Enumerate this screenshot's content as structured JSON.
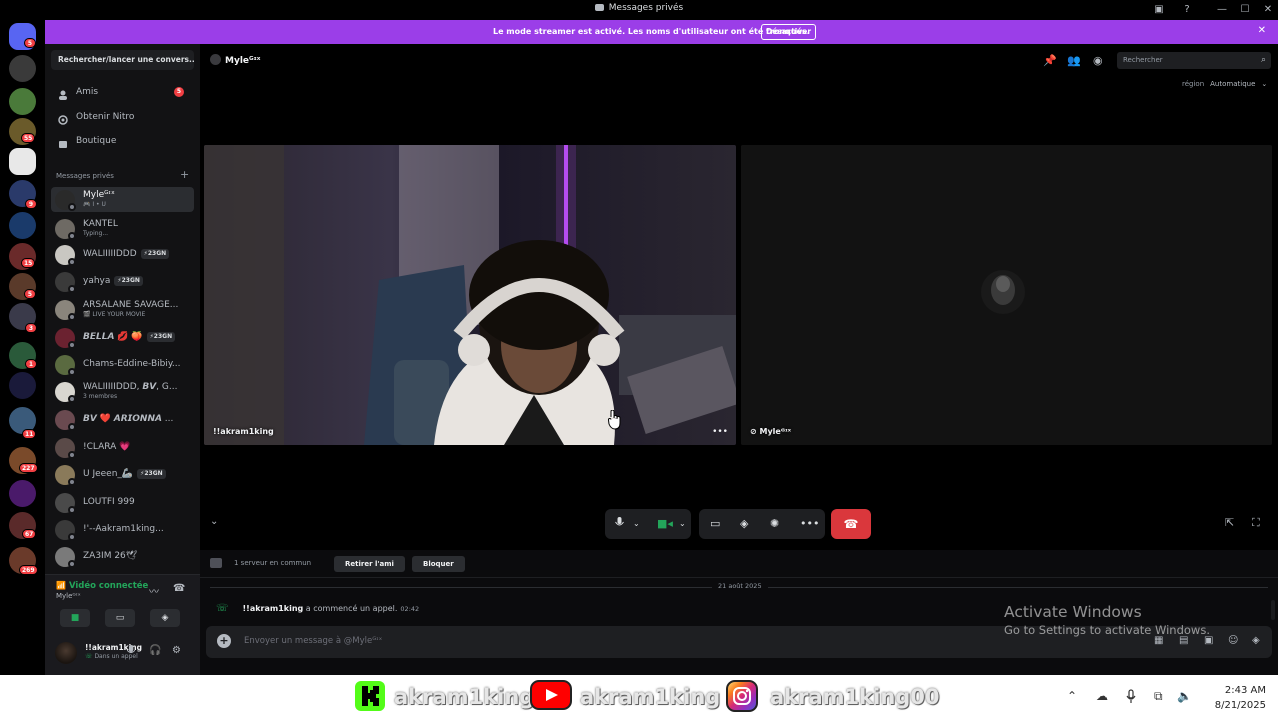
{
  "titlebar": {
    "title": "Messages privés"
  },
  "banner": {
    "text": "Le mode streamer est activé. Les noms d'utilisateur ont été tronqués.",
    "button": "Désactiver"
  },
  "servers": {
    "badges": [
      "5",
      "55",
      "9",
      "15",
      "5",
      "3",
      "1",
      "11",
      "227",
      "67",
      "269"
    ]
  },
  "sidebar": {
    "search": "Rechercher/lancer une convers...",
    "nav": [
      {
        "label": "Amis",
        "badge": "5"
      },
      {
        "label": "Obtenir Nitro"
      },
      {
        "label": "Boutique"
      }
    ],
    "dm_header": "Messages privés",
    "dms": [
      {
        "name": "Myleᴳᶦˣ",
        "sub": "🎮 I • U",
        "selected": true,
        "color": "#2a2a2a"
      },
      {
        "name": "KANTEL",
        "sub": "Typing...",
        "color": "#6e6a64"
      },
      {
        "name": "WALIIIIIDDD",
        "tag": "⚡23GN",
        "color": "#c9c7c2"
      },
      {
        "name": "yahya",
        "tag": "⚡23GN",
        "color": "#3a3a3a"
      },
      {
        "name": "ARSALANE SAVAGE...",
        "sub": "🎬 LIVE YOUR MOVIE",
        "color": "#8a857c"
      },
      {
        "name": "𝘽𝙀𝙇𝙇𝘼 💋 🍑",
        "tag": "⚡23GN",
        "color": "#6b2230"
      },
      {
        "name": "Chams-Eddine-Bibiy...",
        "color": "#5a6a40"
      },
      {
        "name": "WALIIIIIDDD, 𝘽𝙑, G...",
        "sub": "3 membres",
        "color": "#d8d6d0"
      },
      {
        "name": "𝘽𝙑 ❤️ 𝘼𝙍𝙄𝙊𝙉𝙉𝘼 ...",
        "color": "#6a4a50"
      },
      {
        "name": "!CLARA 💗",
        "color": "#5a4a48"
      },
      {
        "name": "U Jeeen_🦾",
        "tag": "⚡23GN",
        "color": "#8a7a5a"
      },
      {
        "name": "LOUTFI 999",
        "color": "#4a4a4a"
      },
      {
        "name": "!'--Aakram1king...",
        "color": "#3a3a3a"
      },
      {
        "name": "ZA3IM 26🕊",
        "color": "#7a7a7a"
      }
    ],
    "voice": {
      "status": "Vidéo connectée",
      "channel": "Myleᴳᶦˣ"
    },
    "user": {
      "name": "!!akram1king",
      "status": "Dans un appel"
    }
  },
  "call": {
    "header_name": "Myleᴳᶦˣ",
    "search_placeholder": "Rechercher",
    "region_label": "région",
    "region_value": "Automatique",
    "tiles": [
      {
        "label": "!!akram1king"
      },
      {
        "label": "Myleᴳᶦˣ"
      }
    ]
  },
  "chat": {
    "common_servers": "1 serveur en commun",
    "remove_friend": "Retirer l'ami",
    "block": "Bloquer",
    "date": "21 août 2025",
    "call_msg_user": "!!akram1king",
    "call_msg_text": " a commencé un appel.",
    "call_msg_time": "02:42",
    "input_placeholder": "Envoyer un message à @Myleᴳᶦˣ"
  },
  "watermark": {
    "line1": "Activate Windows",
    "line2": "Go to Settings to activate Windows."
  },
  "overlay": {
    "kick": "akram1king",
    "youtube": "akram1king",
    "instagram": "akram1king00"
  },
  "taskbar": {
    "time": "2:43 AM",
    "date": "8/21/2025"
  },
  "colors": {
    "banner": "#9b3ee8",
    "online": "#23a55a",
    "hangup": "#da373c",
    "badge": "#f23f43"
  }
}
